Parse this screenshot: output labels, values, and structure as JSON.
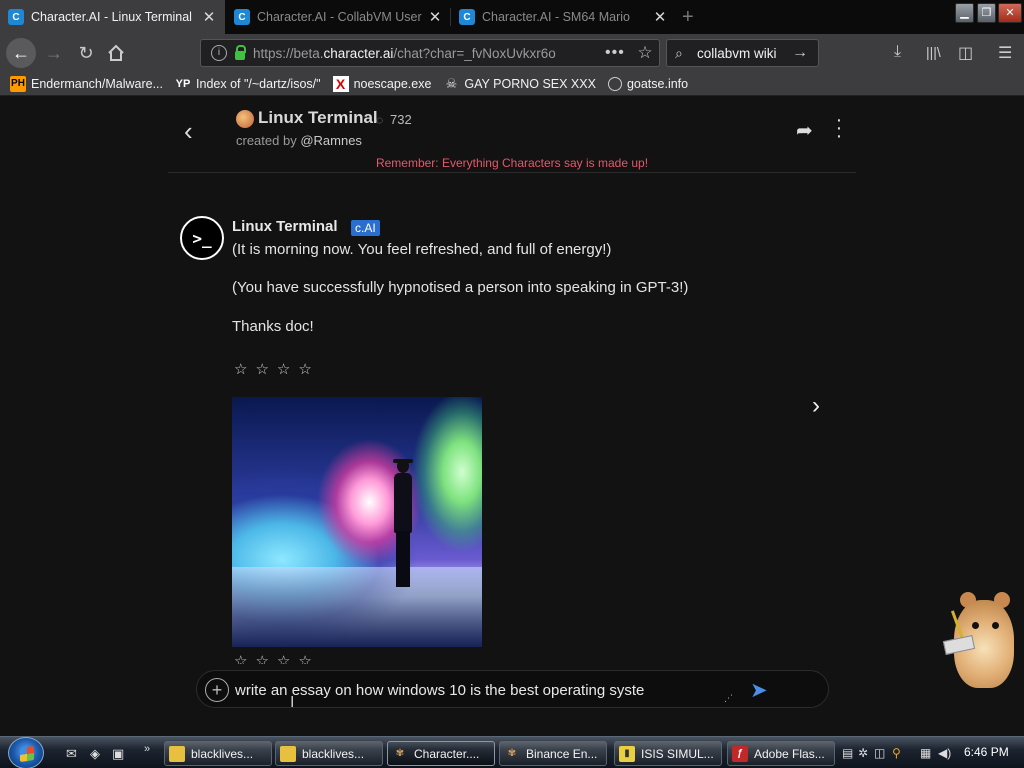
{
  "browser": {
    "tabs": [
      {
        "title": "Character.AI - Linux Terminal",
        "active": true
      },
      {
        "title": "Character.AI - CollabVM User",
        "active": false
      },
      {
        "title": "Character.AI - SM64 Mario",
        "active": false
      }
    ],
    "tab_close_glyph": "✕",
    "new_tab_glyph": "+",
    "url": {
      "prefix": "https://beta.",
      "domain": "character.ai",
      "path": "/chat?char=_fvNoxUvkxr6o"
    },
    "search_value": "collabvm wiki",
    "bookmarks": [
      {
        "label": "Endermanch/Malware...",
        "icon": "PH"
      },
      {
        "label": "Index of \"/~dartz/isos/\"",
        "icon": "YP"
      },
      {
        "label": "noescape.exe",
        "icon": "X"
      },
      {
        "label": "GAY PORNO SEX XXX",
        "icon": "skull-icon"
      },
      {
        "label": "goatse.info",
        "icon": "globe-icon"
      }
    ]
  },
  "chat": {
    "character_name": "Linux Terminal",
    "interaction_count": "732",
    "created_by_prefix": "created by ",
    "creator": "@Ramnes",
    "disclaimer": "Remember: Everything Characters say is made up!",
    "message": {
      "author": "Linux Terminal",
      "badge": "c.AI",
      "avatar_glyph": ">_",
      "lines": [
        "(It is morning now. You feel refreshed, and full of energy!)",
        "(You have successfully hypnotised a person into speaking in GPT-3!)",
        "Thanks doc!"
      ],
      "rating_stars": "☆☆☆☆",
      "image_rating_stars": "☆☆☆☆"
    },
    "composer": {
      "value": "write an essay on how windows 10 is the best operating syste"
    }
  },
  "taskbar": {
    "tasks": [
      {
        "label": "blacklives...",
        "icon_color": "#f0c040"
      },
      {
        "label": "blacklives...",
        "icon_color": "#f0c040"
      },
      {
        "label": "Character....",
        "icon_color": "#d8a060",
        "active": true
      },
      {
        "label": "Binance En...",
        "icon_color": "#d8a060"
      },
      {
        "label": "ISIS SIMUL...",
        "icon_color": "#e8d040"
      },
      {
        "label": "Adobe Flas...",
        "icon_color": "#c0282a"
      }
    ],
    "clock": "6:46 PM"
  },
  "colors": {
    "accent_blue": "#4a8ee8",
    "badge_blue": "#2a6fcf",
    "disclaimer_red": "#e05a6a",
    "page_bg": "#121212"
  }
}
